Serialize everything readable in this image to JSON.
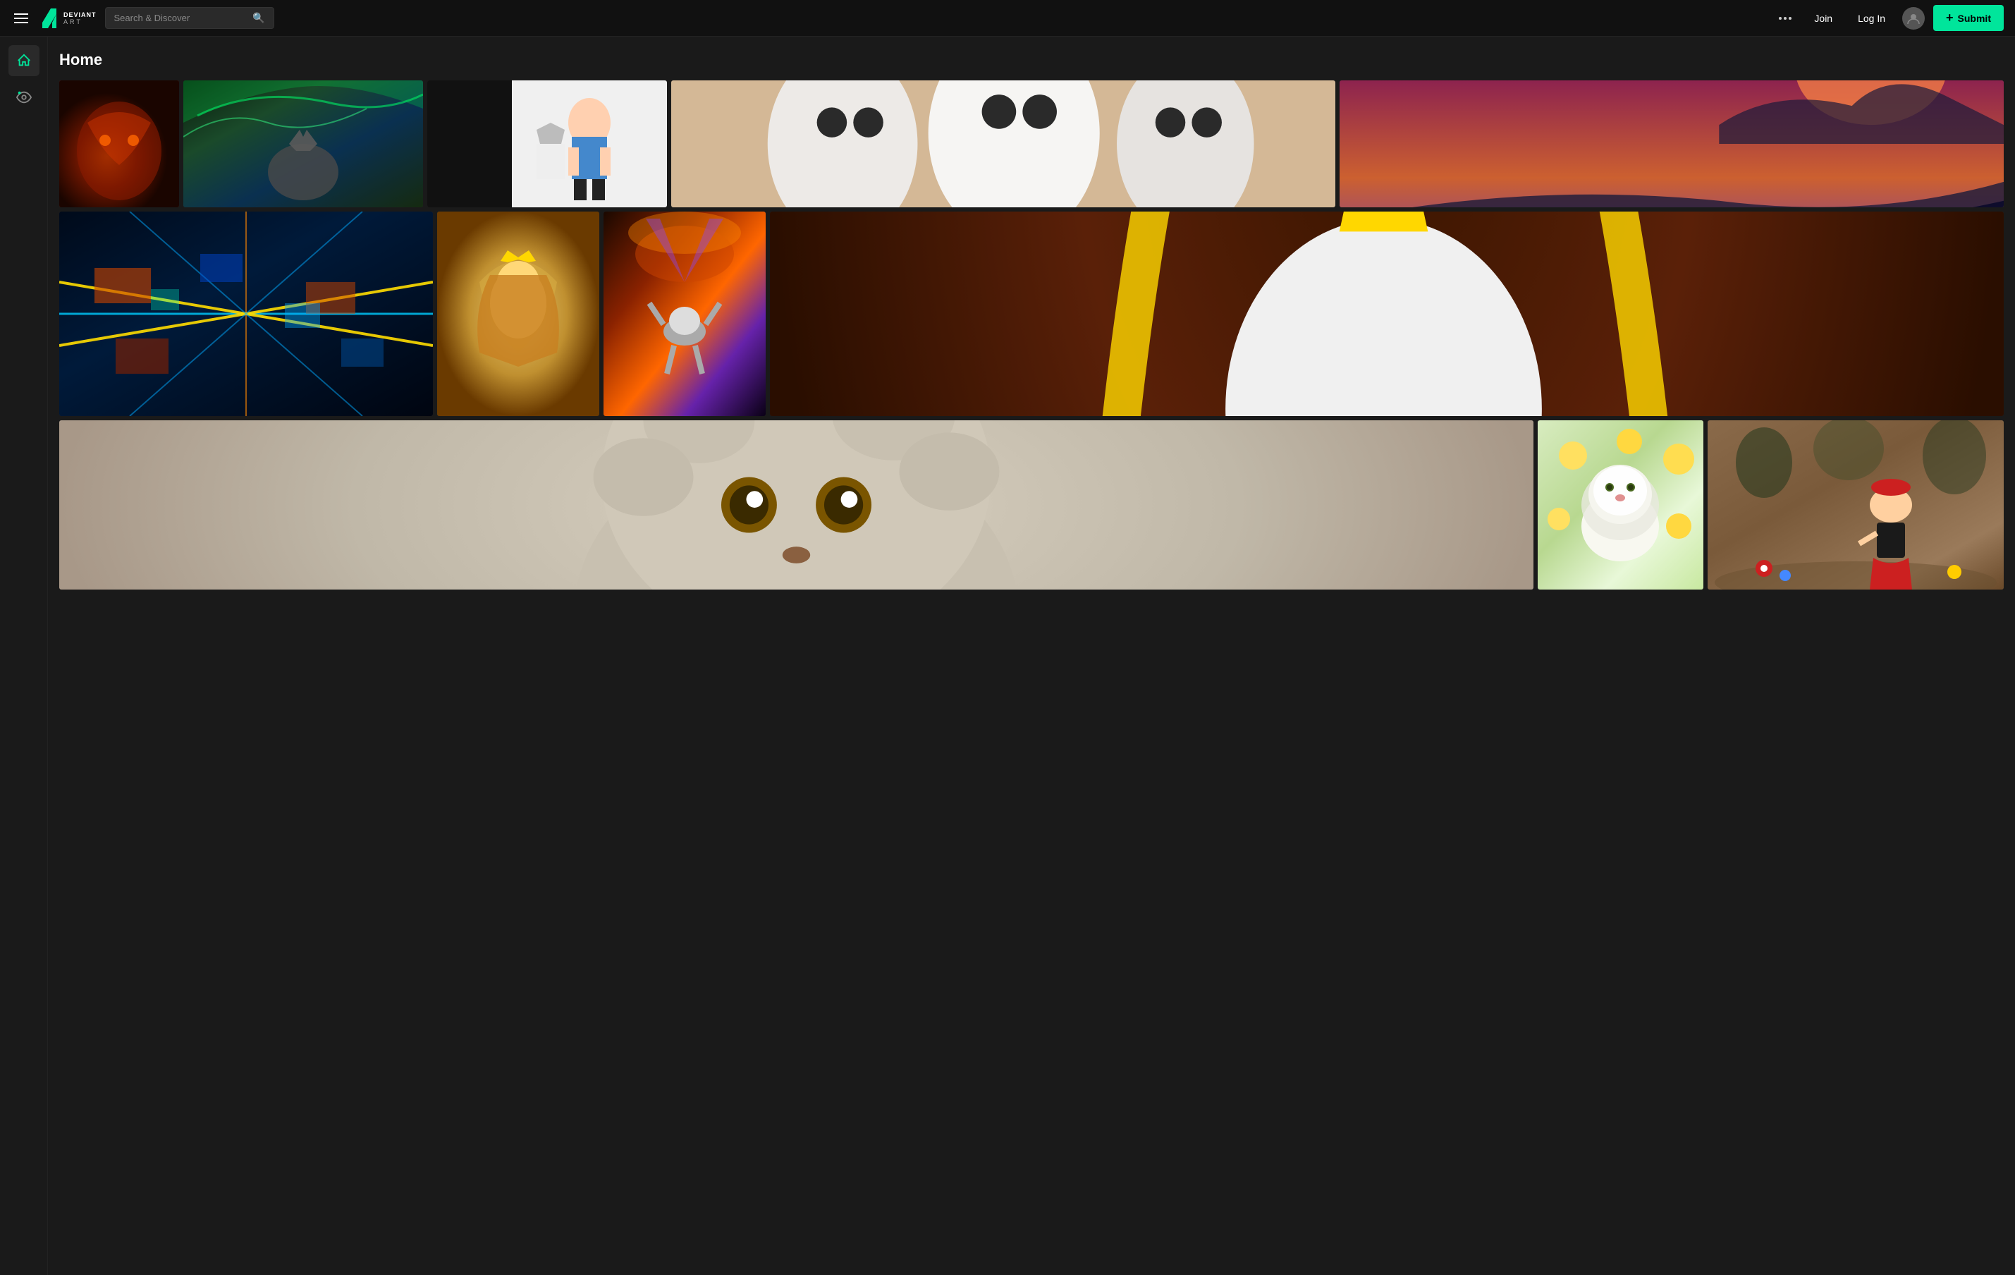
{
  "header": {
    "menu_icon": "hamburger-menu",
    "logo_main": "DEVIANT",
    "logo_sub": "ART",
    "search_placeholder": "Search & Discover",
    "more_label": "more",
    "join_label": "Join",
    "login_label": "Log In",
    "submit_label": "Submit",
    "submit_plus": "+"
  },
  "sidebar": {
    "items": [
      {
        "id": "home",
        "icon": "home-icon",
        "active": true
      },
      {
        "id": "watch",
        "icon": "watch-icon",
        "active": false
      }
    ]
  },
  "main": {
    "page_title": "Home"
  },
  "gallery": {
    "rows": [
      {
        "id": "row1",
        "items": [
          {
            "id": "dragon",
            "alt": "Dragon artwork",
            "style_class": "art-dragon"
          },
          {
            "id": "wolf",
            "alt": "Wolf with aurora borealis",
            "style_class": "art-wolf"
          },
          {
            "id": "alice",
            "alt": "Alice in Wonderland cosplay",
            "style_class": "art-alice"
          },
          {
            "id": "owls",
            "alt": "Owl pendants jewelry",
            "style_class": "art-owls"
          },
          {
            "id": "coast",
            "alt": "Coastal sunset landscape",
            "style_class": "art-coast"
          }
        ]
      },
      {
        "id": "row2",
        "items": [
          {
            "id": "circuit",
            "alt": "Neon circuit city",
            "style_class": "art-circuit"
          },
          {
            "id": "lion-girl",
            "alt": "Girl with lion crown",
            "style_class": "art-lion-girl"
          },
          {
            "id": "astronaut",
            "alt": "Astronaut on Mars",
            "style_class": "art-astronaut"
          },
          {
            "id": "unicorn",
            "alt": "Unicorn with golden arch",
            "style_class": "art-unicorn"
          }
        ]
      },
      {
        "id": "row3",
        "items": [
          {
            "id": "fluffy",
            "alt": "Fluffy cute creature",
            "style_class": "art-fluffy"
          },
          {
            "id": "white-lion",
            "alt": "White lion with sunflowers",
            "style_class": "art-white-lion"
          },
          {
            "id": "pokemon",
            "alt": "Pokemon cosplay photo",
            "style_class": "art-pokemon"
          }
        ]
      }
    ]
  }
}
